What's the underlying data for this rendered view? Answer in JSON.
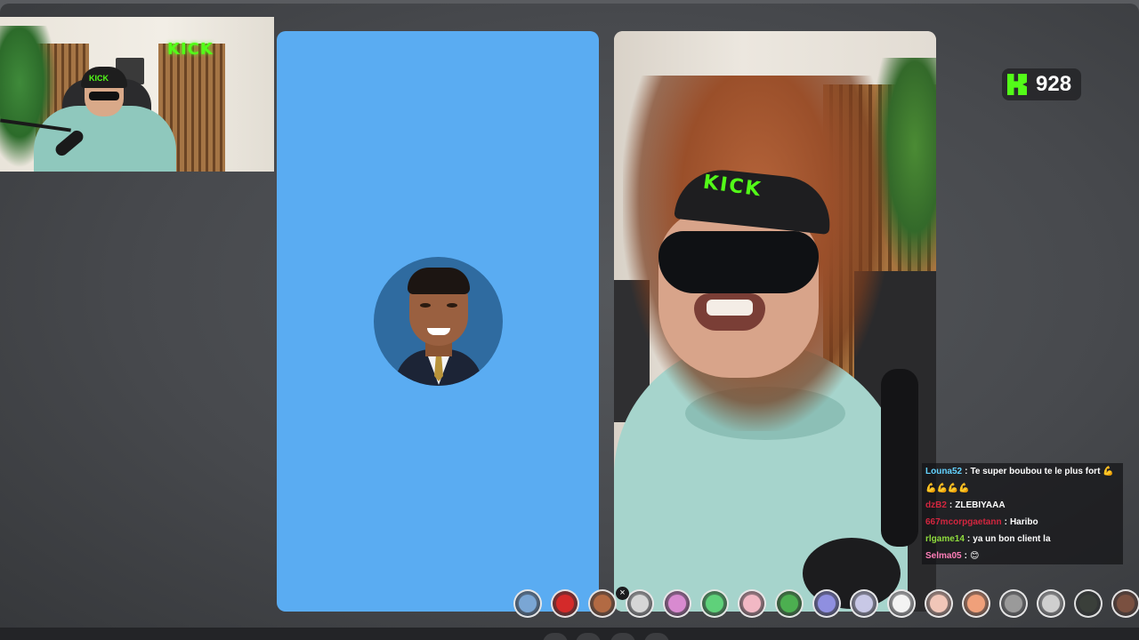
{
  "webcam": {
    "sign_text": "KICK",
    "cap_text": "KICK"
  },
  "video": {
    "cap_logo_text": "KICK"
  },
  "viewer_counter": {
    "value": "928",
    "icon": "kick-logo-icon",
    "accent": "#53fc18"
  },
  "chat": {
    "messages": [
      {
        "user": "Louna52",
        "user_color": "#63d2ff",
        "separator": ":",
        "text": "Te super boubou te le plus fort 💪"
      },
      {
        "user": "",
        "user_color": "#ffffff",
        "separator": "",
        "text": "💪💪💪💪"
      },
      {
        "user": "dzB2",
        "user_color": "#d3263f",
        "separator": ":",
        "text": "ZLEBIYAAA"
      },
      {
        "user": "667mcorpgaetann",
        "user_color": "#d3263f",
        "separator": ":",
        "text": "Haribo"
      },
      {
        "user": "rlgame14",
        "user_color": "#8fdc3d",
        "separator": ":",
        "text": "ya un bon client la"
      },
      {
        "user": "Selma05",
        "user_color": "#ff7eb8",
        "separator": ":",
        "text": "😊"
      }
    ]
  },
  "filter_bar": {
    "close_label": "×",
    "items": [
      {
        "name": "filter-none",
        "color": "#7aa6d4"
      },
      {
        "name": "filter-devil",
        "color": "#d42a2a"
      },
      {
        "name": "filter-wig",
        "color": "#b26a43"
      },
      {
        "name": "filter-sad",
        "color": "#d6d6d6"
      },
      {
        "name": "filter-clown",
        "color": "#d88ad0"
      },
      {
        "name": "filter-green-face",
        "color": "#5fd17a"
      },
      {
        "name": "filter-blush",
        "color": "#f2b8c4"
      },
      {
        "name": "filter-alien",
        "color": "#4caf50"
      },
      {
        "name": "filter-purple",
        "color": "#8f8fe0"
      },
      {
        "name": "filter-ghost",
        "color": "#c8c8e6"
      },
      {
        "name": "filter-white-face",
        "color": "#f3f3f3"
      },
      {
        "name": "filter-peach",
        "color": "#f1c6b8"
      },
      {
        "name": "filter-orange",
        "color": "#f0a07a"
      },
      {
        "name": "filter-gray",
        "color": "#9a9a9a"
      },
      {
        "name": "filter-silver",
        "color": "#cfcfcf"
      },
      {
        "name": "filter-dark",
        "color": "#3a3f3a"
      },
      {
        "name": "filter-brown",
        "color": "#7a5040"
      }
    ]
  }
}
